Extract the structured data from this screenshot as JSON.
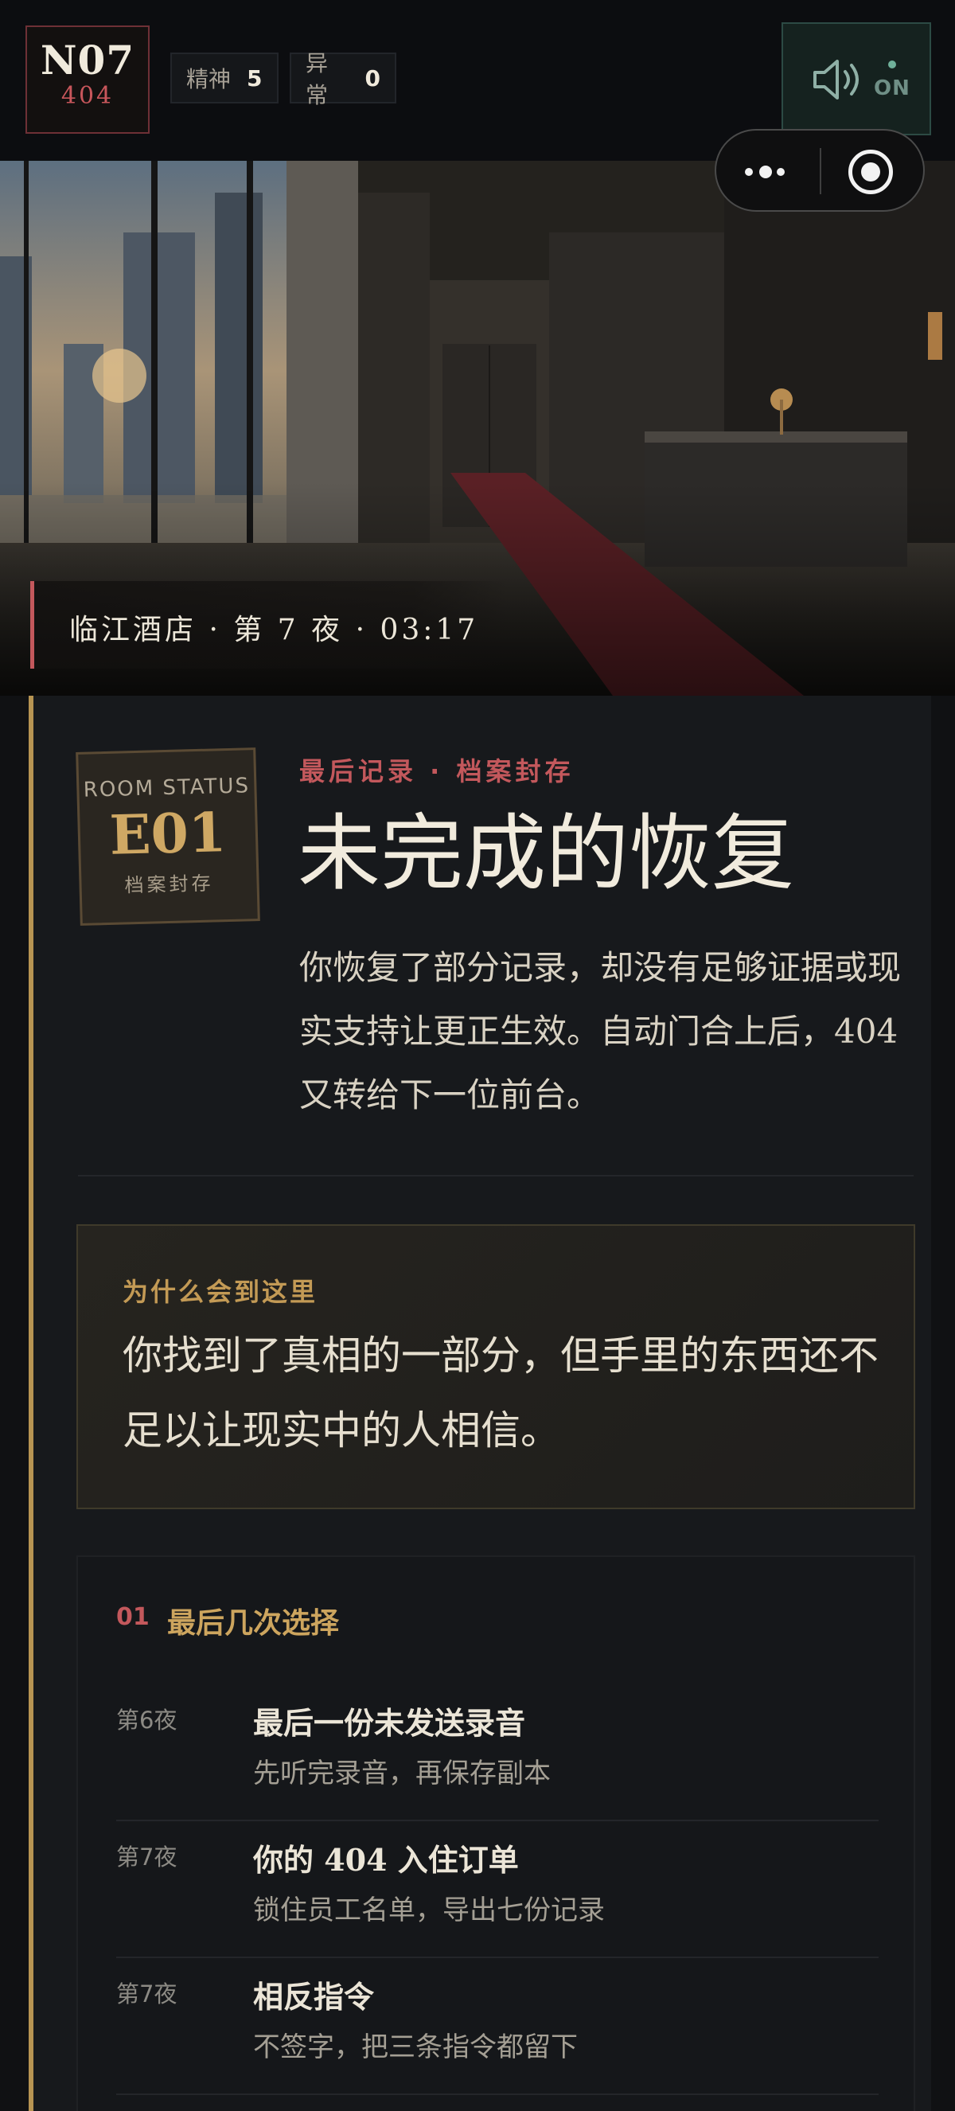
{
  "header": {
    "night": "N07",
    "room": "404",
    "stats": [
      {
        "label": "精神",
        "value": "5"
      },
      {
        "label": "异常",
        "value": "0"
      }
    ],
    "sound": {
      "icon": "speaker-icon",
      "state": "ON",
      "state_color": "#6fb09a"
    },
    "capsule": {
      "more_icon": "more-dots-icon",
      "close_icon": "target-close-icon"
    }
  },
  "hero": {
    "location": "临江酒店 · 第 7 夜 · 03:17",
    "accent": "#c3585c"
  },
  "ending": {
    "badge": {
      "top": "ROOM STATUS",
      "code": "E01",
      "sub": "档案封存"
    },
    "kicker": "最后记录 · 档案封存",
    "title": "未完成的恢复",
    "description": "你恢复了部分记录，却没有足够证据或现实支持让更正生效。自动门合上后，404 又转给下一位前台。",
    "why": {
      "label": "为什么会到这里",
      "text": "你找到了真相的一部分，但手里的东西还不足以让现实中的人相信。"
    },
    "choices": {
      "index": "01",
      "title": "最后几次选择",
      "items": [
        {
          "night": "第6夜",
          "title": "最后一份未发送录音",
          "detail": "先听完录音，再保存副本"
        },
        {
          "night": "第7夜",
          "title": "你的 404 入住订单",
          "detail": "锁住员工名单，导出七份记录"
        },
        {
          "night": "第7夜",
          "title": "相反指令",
          "detail": "不签字，把三条指令都留下"
        }
      ]
    }
  },
  "colors": {
    "gold": "#b79452",
    "red": "#c3585c",
    "background": "#101113"
  }
}
